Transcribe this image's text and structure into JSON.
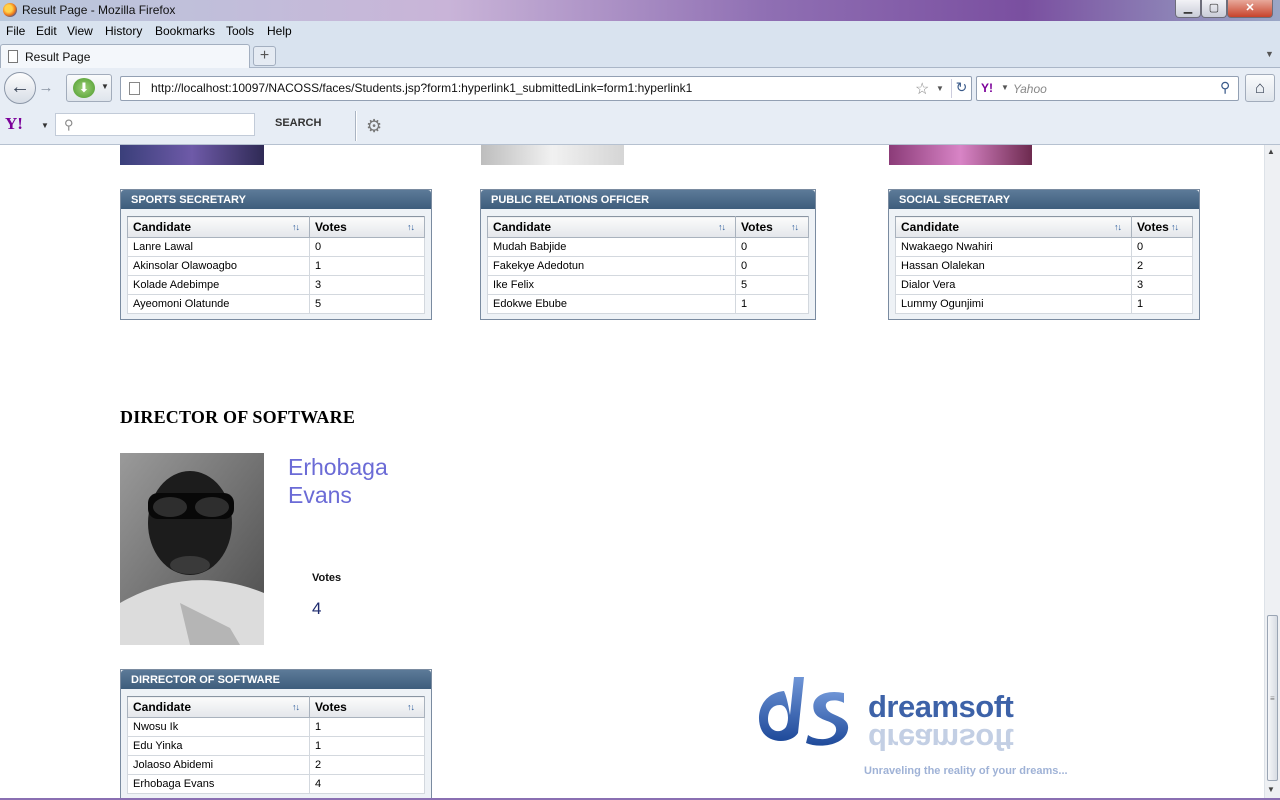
{
  "window": {
    "title": "Result Page - Mozilla Firefox",
    "minimize": "▁",
    "maximize": "▢",
    "close": "✕"
  },
  "menu": [
    "File",
    "Edit",
    "View",
    "History",
    "Bookmarks",
    "Tools",
    "Help"
  ],
  "tab": {
    "label": "Result Page",
    "new_tab": "+",
    "list": "▼"
  },
  "nav": {
    "back": "←",
    "forward": "→",
    "download": "⬇",
    "url": "http://localhost:10097/NACOSS/faces/Students.jsp?form1:hyperlink1_submittedLink=form1:hyperlink1",
    "star": "☆",
    "reload": "↻",
    "search_engine": "Y!",
    "search_placeholder": "Yahoo",
    "search_icon": "⚲",
    "home": "⌂"
  },
  "yahoo_toolbar": {
    "logo": "Y!",
    "search_button": "SEARCH",
    "gear": "⚙"
  },
  "panels": [
    {
      "title": "SPORTS SECRETARY",
      "col_candidate": "Candidate",
      "col_votes": "Votes",
      "rows": [
        {
          "name": "Lanre Lawal",
          "votes": "0"
        },
        {
          "name": "Akinsolar Olawoagbo",
          "votes": "1"
        },
        {
          "name": "Kolade Adebimpe",
          "votes": "3"
        },
        {
          "name": "Ayeomoni Olatunde",
          "votes": "5"
        }
      ]
    },
    {
      "title": "PUBLIC RELATIONS OFFICER",
      "col_candidate": "Candidate",
      "col_votes": "Votes",
      "rows": [
        {
          "name": "Mudah Babjide",
          "votes": "0"
        },
        {
          "name": "Fakekye Adedotun",
          "votes": "0"
        },
        {
          "name": "Ike Felix",
          "votes": "5"
        },
        {
          "name": "Edokwe Ebube",
          "votes": "1"
        }
      ]
    },
    {
      "title": "SOCIAL SECRETARY",
      "col_candidate": "Candidate",
      "col_votes": "Votes",
      "rows": [
        {
          "name": "Nwakaego Nwahiri",
          "votes": "0"
        },
        {
          "name": "Hassan Olalekan",
          "votes": "2"
        },
        {
          "name": "Dialor Vera",
          "votes": "3"
        },
        {
          "name": "Lummy Ogunjimi",
          "votes": "1"
        }
      ]
    },
    {
      "title": "DIRRECTOR OF SOFTWARE",
      "col_candidate": "Candidate",
      "col_votes": "Votes",
      "rows": [
        {
          "name": "Nwosu Ik",
          "votes": "1"
        },
        {
          "name": "Edu Yinka",
          "votes": "1"
        },
        {
          "name": "Jolaoso Abidemi",
          "votes": "2"
        },
        {
          "name": "Erhobaga Evans",
          "votes": "4"
        }
      ]
    }
  ],
  "winner": {
    "section_heading": "DIRECTOR OF SOFTWARE",
    "name_line1": "Erhobaga",
    "name_line2": "Evans",
    "votes_label": "Votes",
    "votes": "4"
  },
  "logo": {
    "word": "dreamsoft",
    "tagline": "Unraveling the reality of your dreams..."
  },
  "sort_glyph": "↑↓",
  "colors": {
    "header": "#3e5d7c",
    "name_link": "#6b6bd6",
    "logo_blue": "#3d62a8"
  }
}
